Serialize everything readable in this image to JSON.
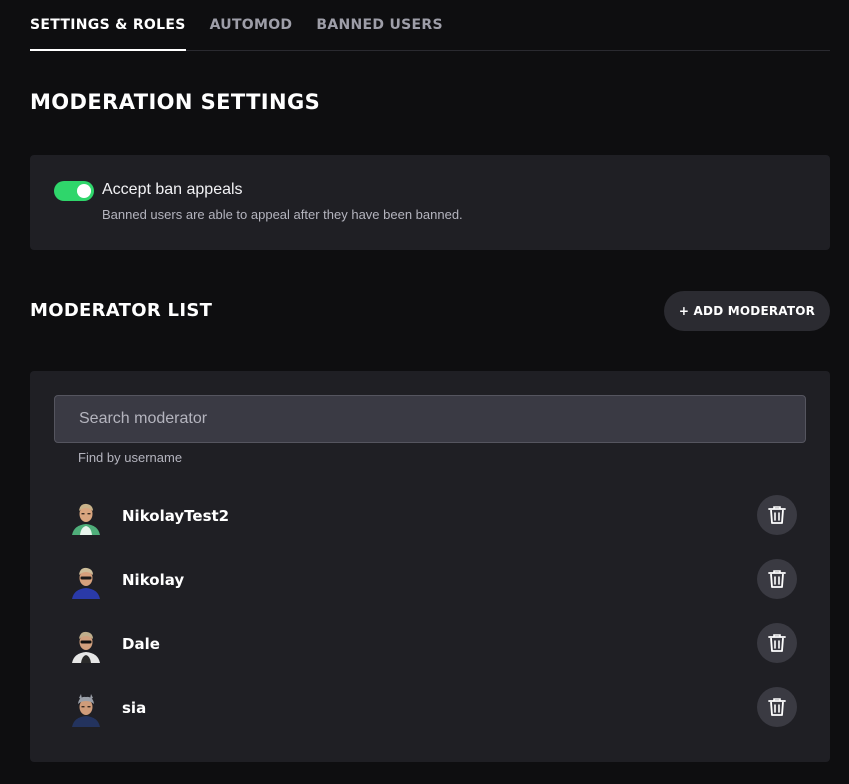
{
  "tabs": [
    {
      "label": "SETTINGS & ROLES",
      "active": true
    },
    {
      "label": "AUTOMOD",
      "active": false
    },
    {
      "label": "BANNED USERS",
      "active": false
    }
  ],
  "moderation": {
    "title": "MODERATION SETTINGS",
    "appeals": {
      "enabled": true,
      "label": "Accept ban appeals",
      "description": "Banned users are able to appeal after they have been banned."
    }
  },
  "moderator_list": {
    "title": "MODERATOR LIST",
    "add_button": "+ ADD MODERATOR",
    "search": {
      "placeholder": "Search moderator",
      "value": ""
    },
    "hint": "Find by username",
    "moderators": [
      {
        "name": "NikolayTest2",
        "avatar": "avatar-nikolaytest2-icon"
      },
      {
        "name": "Nikolay",
        "avatar": "avatar-nikolay-icon"
      },
      {
        "name": "Dale",
        "avatar": "avatar-dale-icon"
      },
      {
        "name": "sia",
        "avatar": "avatar-sia-icon"
      }
    ]
  },
  "colors": {
    "background": "#0e0e10",
    "card": "#1f1f24",
    "toggle_on": "#2fd66b",
    "muted_text": "#b4b4be"
  }
}
